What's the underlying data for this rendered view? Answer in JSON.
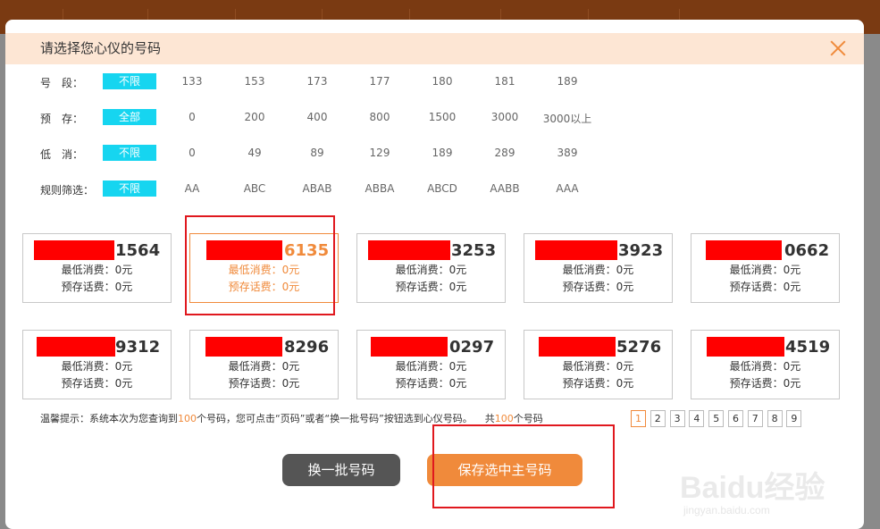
{
  "dialog": {
    "title": "请选择您心仪的号码"
  },
  "filters": [
    {
      "label": "号　段：",
      "active": "不限",
      "options": [
        "133",
        "153",
        "173",
        "177",
        "180",
        "181",
        "189"
      ]
    },
    {
      "label": "预　存：",
      "active": "全部",
      "options": [
        "0",
        "200",
        "400",
        "800",
        "1500",
        "3000",
        "3000以上"
      ]
    },
    {
      "label": "低　消：",
      "active": "不限",
      "options": [
        "0",
        "49",
        "89",
        "129",
        "189",
        "289",
        "389"
      ]
    },
    {
      "label": "规则筛选：",
      "active": "不限",
      "options": [
        "AA",
        "ABC",
        "ABAB",
        "ABBA",
        "ABCD",
        "AABB",
        "AAA"
      ]
    }
  ],
  "numbers": [
    {
      "suffix": "1564",
      "min_fee": "最低消费：0元",
      "prestore": "预存话费：0元",
      "selected": false
    },
    {
      "suffix": "6135",
      "min_fee": "最低消费：0元",
      "prestore": "预存话费：0元",
      "selected": true
    },
    {
      "suffix": "3253",
      "min_fee": "最低消费：0元",
      "prestore": "预存话费：0元",
      "selected": false
    },
    {
      "suffix": "3923",
      "min_fee": "最低消费：0元",
      "prestore": "预存话费：0元",
      "selected": false
    },
    {
      "suffix": "0662",
      "min_fee": "最低消费：0元",
      "prestore": "预存话费：0元",
      "selected": false
    },
    {
      "suffix": "9312",
      "min_fee": "最低消费：0元",
      "prestore": "预存话费：0元",
      "selected": false
    },
    {
      "suffix": "8296",
      "min_fee": "最低消费：0元",
      "prestore": "预存话费：0元",
      "selected": false
    },
    {
      "suffix": "0297",
      "min_fee": "最低消费：0元",
      "prestore": "预存话费：0元",
      "selected": false
    },
    {
      "suffix": "5276",
      "min_fee": "最低消费：0元",
      "prestore": "预存话费：0元",
      "selected": false
    },
    {
      "suffix": "4519",
      "min_fee": "最低消费：0元",
      "prestore": "预存话费：0元",
      "selected": false
    }
  ],
  "hint": {
    "prefix": "温馨提示：系统本次为您查询到",
    "count": "100",
    "middle": "个号码，您可点击“页码”或者“换一批号码”按钮选到心仪号码。",
    "total_prefix": "共",
    "total_count": "100",
    "total_suffix": "个号码"
  },
  "pagination": {
    "pages": [
      "1",
      "2",
      "3",
      "4",
      "5",
      "6",
      "7",
      "8",
      "9"
    ],
    "current": "1"
  },
  "buttons": {
    "refresh_label": "换一批号码",
    "save_label": "保存选中主号码"
  },
  "watermark": {
    "logo_text": "Baidu经验",
    "site": "jingyan.baidu.com"
  },
  "colors": {
    "accent": "#f08a3b",
    "filter_active": "#16d5f0",
    "redaction": "#ff0000",
    "header_bg": "#fde6d4"
  }
}
